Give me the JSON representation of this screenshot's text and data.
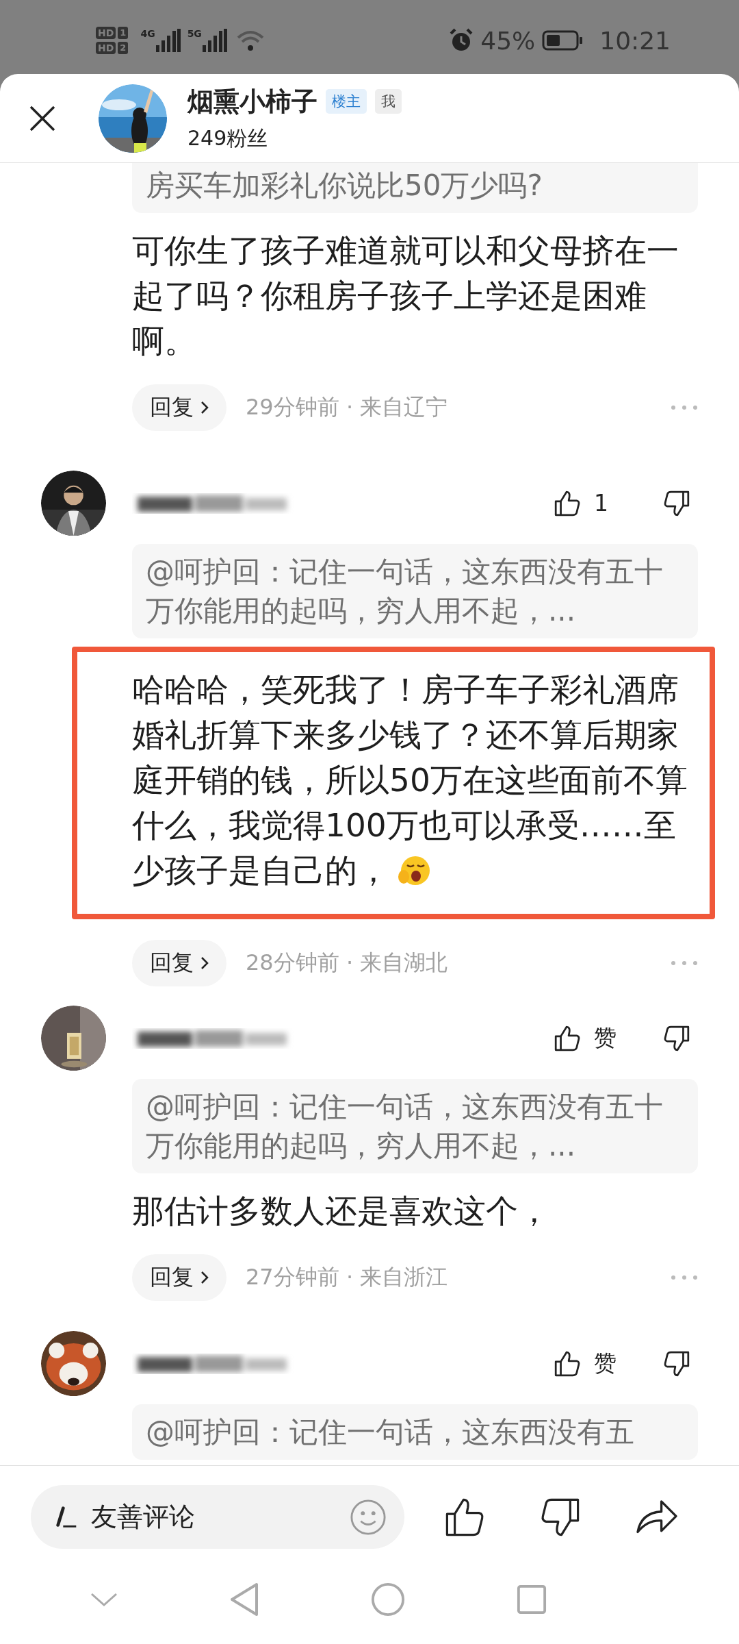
{
  "status_bar": {
    "sims": [
      {
        "tag": "HD",
        "slot": "1"
      },
      {
        "tag": "HD",
        "slot": "2"
      }
    ],
    "networks": [
      "4G",
      "5G"
    ],
    "battery": "45%",
    "time": "10:21"
  },
  "header": {
    "author": "烟熏小柿子",
    "badges": [
      {
        "label": "楼主",
        "kind": "owner"
      },
      {
        "label": "我",
        "kind": "self"
      }
    ],
    "fans": "249粉丝"
  },
  "comments": [
    {
      "partial": true,
      "quote": "房买车加彩礼你说比50万少吗?",
      "text": "可你生了孩子难道就可以和父母挤在一起了吗？你租房子孩子上学还是困难啊。",
      "emoji": false,
      "highlighted": false,
      "reply_label": "回复",
      "meta": "29分钟前 · 来自辽宁"
    },
    {
      "partial": false,
      "name_blurred": true,
      "likes": "1",
      "quote": "@呵护回：记住一句话，这东西没有五十万你能用的起吗，穷人用不起，...",
      "text": "哈哈哈，笑死我了！房子车子彩礼酒席婚礼折算下来多少钱了？还不算后期家庭开销的钱，所以50万在这些面前不算什么，我觉得100万也可以承受……至少孩子是自己的，",
      "emoji": true,
      "highlighted": true,
      "reply_label": "回复",
      "meta": "28分钟前 · 来自湖北"
    },
    {
      "partial": false,
      "name_blurred": true,
      "likes": "赞",
      "quote": "@呵护回：记住一句话，这东西没有五十万你能用的起吗，穷人用不起，...",
      "text": "那估计多数人还是喜欢这个，",
      "emoji": false,
      "highlighted": false,
      "reply_label": "回复",
      "meta": "27分钟前 · 来自浙江"
    },
    {
      "partial": false,
      "name_blurred": true,
      "likes": "赞",
      "quote": "@呵护回：记住一句话，这东西没有五"
    }
  ],
  "composer": {
    "placeholder": "友善评论"
  }
}
